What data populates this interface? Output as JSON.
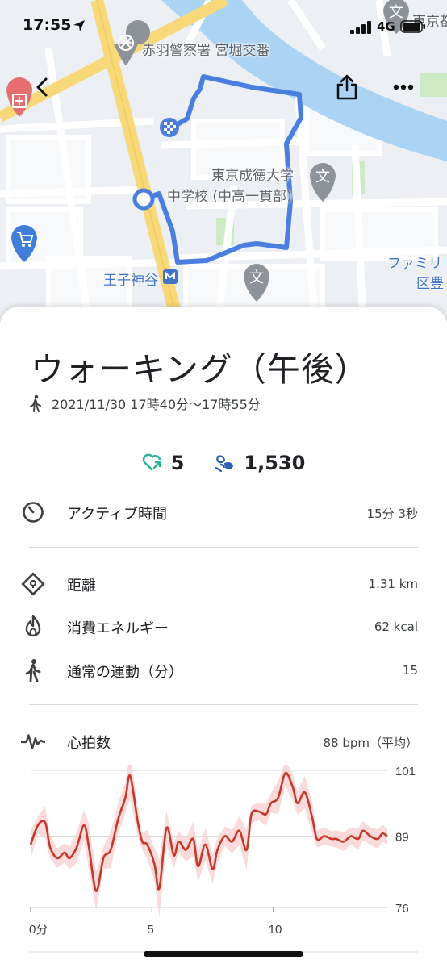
{
  "status": {
    "time": "17:55",
    "network": "4G"
  },
  "map": {
    "labels": {
      "police": "赤羽警察署 宮堀交番",
      "university_1": "東京成徳大学",
      "university_2": "中学校 (中高一貫部)",
      "station": "王子神谷",
      "corner_top": "東京都",
      "family_1": "ファミリ",
      "family_2": "区豊"
    }
  },
  "activity": {
    "title": "ウォーキング（午後）",
    "datetime": "2021/11/30 17時40分〜17時55分",
    "heart_points": "5",
    "steps": "1,530"
  },
  "stats": {
    "active_time": {
      "label": "アクティブ時間",
      "value": "15分 3秒"
    },
    "distance": {
      "label": "距離",
      "value": "1.31 km"
    },
    "energy": {
      "label": "消費エネルギー",
      "value": "62 kcal"
    },
    "move": {
      "label": "通常の運動（分）",
      "value": "15"
    }
  },
  "heart_rate": {
    "label": "心拍数",
    "value": "88 bpm（平均）"
  },
  "colors": {
    "route": "#4a7fe0",
    "heart_line": "#c5392b",
    "heart_band": "#f7d2d2",
    "teal": "#2bb39a",
    "steps_blue": "#2f5fb5"
  },
  "chart_data": {
    "type": "line",
    "title": "",
    "xlabel": "",
    "ylabel": "",
    "x_ticks": [
      "0分",
      "5",
      "10"
    ],
    "y_ticks": [
      "101",
      "89",
      "76"
    ],
    "ylim": [
      76,
      101
    ],
    "xlim": [
      0,
      14.7
    ],
    "x": [
      0,
      0.3,
      0.6,
      0.8,
      1.1,
      1.4,
      1.6,
      1.9,
      2.2,
      2.4,
      2.7,
      3.0,
      3.3,
      3.6,
      3.9,
      4.1,
      4.4,
      4.6,
      4.8,
      5.1,
      5.3,
      5.6,
      5.9,
      6.1,
      6.4,
      6.7,
      6.9,
      7.2,
      7.5,
      7.7,
      8.0,
      8.3,
      8.6,
      8.9,
      9.1,
      9.4,
      9.7,
      9.9,
      10.2,
      10.5,
      10.8,
      11.0,
      11.3,
      11.6,
      11.8,
      12.1,
      12.4,
      12.6,
      12.9,
      13.2,
      13.5,
      13.7,
      14.0,
      14.3,
      14.5,
      14.7
    ],
    "series": [
      {
        "values": [
          87.5,
          91.0,
          91.5,
          87.0,
          85.0,
          86.0,
          85.0,
          87.0,
          91.0,
          87.0,
          79.0,
          85.0,
          86.5,
          92.0,
          96.0,
          100.0,
          92.0,
          88.0,
          87.5,
          84.0,
          79.5,
          90.5,
          85.5,
          88.0,
          86.5,
          88.5,
          83.5,
          87.5,
          83.0,
          86.5,
          89.0,
          88.0,
          90.0,
          86.5,
          93.0,
          93.5,
          93.0,
          95.0,
          96.0,
          100.5,
          98.0,
          95.0,
          97.0,
          92.5,
          88.5,
          89.0,
          88.5,
          88.5,
          88.0,
          89.0,
          88.5,
          90.0,
          89.0,
          88.5,
          89.5,
          89.0
        ]
      }
    ],
    "grid": true,
    "legend": "none"
  }
}
